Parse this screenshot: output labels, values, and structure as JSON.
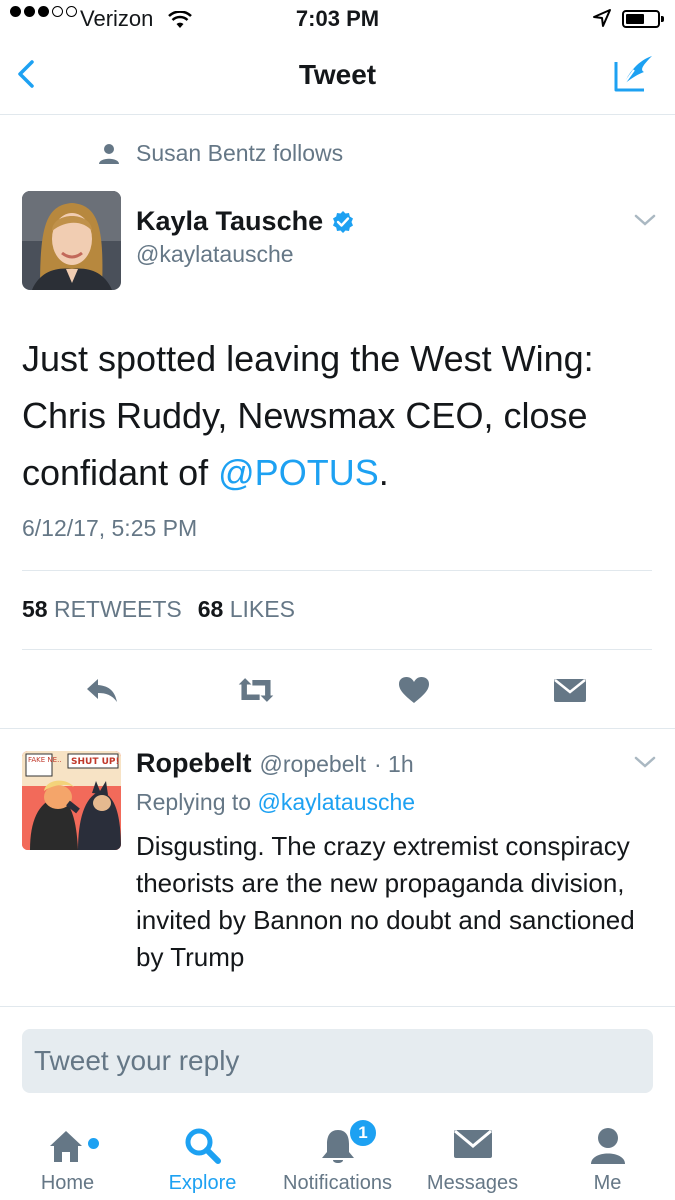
{
  "status_bar": {
    "carrier": "Verizon",
    "time": "7:03 PM"
  },
  "nav": {
    "title": "Tweet"
  },
  "context": {
    "text": "Susan Bentz follows"
  },
  "tweet": {
    "name": "Kayla Tausche",
    "handle": "@kaylatausche",
    "text_before": "Just spotted leaving the West Wing: Chris Ruddy, Newsmax CEO, close confidant of ",
    "mention": "@POTUS",
    "text_after": ".",
    "timestamp": "6/12/17, 5:25 PM",
    "retweets_count": "58",
    "retweets_label": "RETWEETS",
    "likes_count": "68",
    "likes_label": "LIKES"
  },
  "reply": {
    "name": "Ropebelt",
    "handle": "@ropebelt",
    "age": "· 1h",
    "replying_label": "Replying to",
    "replying_to": "@kaylatausche",
    "text": "Disgusting. The crazy extremist conspiracy theorists are the new propaganda division, invited by Bannon no doubt and sanctioned by Trump",
    "avatar_text_1": "FAKE NE..",
    "avatar_text_2": "SHUT UP!"
  },
  "composer": {
    "placeholder": "Tweet your reply"
  },
  "tabs": [
    {
      "label": "Home",
      "icon": "home-icon"
    },
    {
      "label": "Explore",
      "icon": "search-icon"
    },
    {
      "label": "Notifications",
      "icon": "bell-icon",
      "badge": "1"
    },
    {
      "label": "Messages",
      "icon": "envelope-icon"
    },
    {
      "label": "Me",
      "icon": "person-icon"
    }
  ],
  "colors": {
    "accent": "#1da1f2",
    "text": "#14171a",
    "muted": "#657786",
    "divider": "#e1e8ed"
  }
}
